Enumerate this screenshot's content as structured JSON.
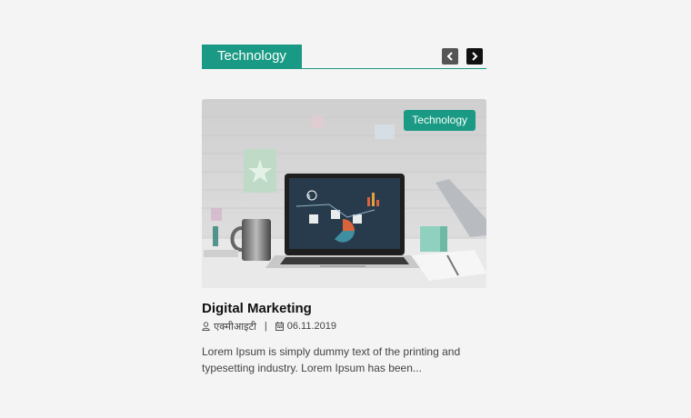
{
  "section": {
    "title": "Technology",
    "prev_icon": "chevron-left-icon",
    "next_icon": "chevron-right-icon"
  },
  "post": {
    "category": "Technology",
    "title": "Digital Marketing",
    "author": "एक्मीआइटी",
    "author_icon": "user-icon",
    "date": "06.11.2019",
    "date_icon": "calendar-icon",
    "excerpt": "Lorem Ipsum is simply dummy text of the printing and typesetting industry. Lorem Ipsum has been..."
  },
  "colors": {
    "accent": "#1a9a84",
    "background": "#f4f4f4",
    "title_text": "#111111",
    "body_text": "#444444"
  }
}
